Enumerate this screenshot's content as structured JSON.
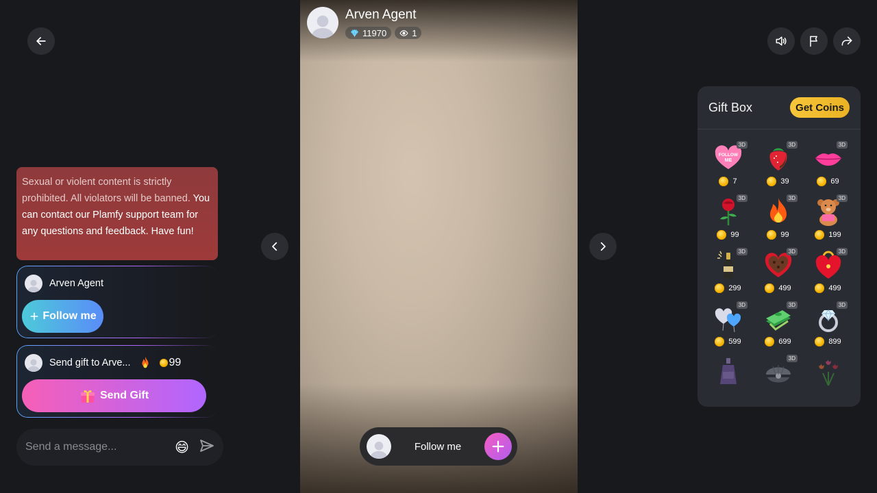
{
  "notice": {
    "text_muted": "Sexual or violent content is strictly prohibited. All violators will be banned.",
    "text_main": "You can contact our Plamfy support team for any questions and feedback. Have fun!"
  },
  "host": {
    "name": "Arven Agent",
    "diamonds": "11970",
    "viewers": "1"
  },
  "follow_card": {
    "name": "Arven Agent",
    "button_label": "Follow me"
  },
  "gift_card": {
    "text": "Send gift to Arve...",
    "gift_icon": "fire",
    "price": "99",
    "button_label": "Send Gift"
  },
  "message": {
    "placeholder": "Send a message..."
  },
  "follow_bar": {
    "label": "Follow me"
  },
  "giftbox": {
    "title": "Gift Box",
    "get_coins": "Get Coins",
    "badge": "3D",
    "items": [
      {
        "name": "follow-me-heart",
        "price": "7",
        "badge": true
      },
      {
        "name": "chocolate-strawberry",
        "price": "39",
        "badge": true
      },
      {
        "name": "lips",
        "price": "69",
        "badge": true
      },
      {
        "name": "rose",
        "price": "99",
        "badge": true
      },
      {
        "name": "fire",
        "price": "99",
        "badge": true
      },
      {
        "name": "teddy-bear",
        "price": "199",
        "badge": true
      },
      {
        "name": "champagne",
        "price": "299",
        "badge": true
      },
      {
        "name": "heart-chocolate-box",
        "price": "499",
        "badge": true
      },
      {
        "name": "heart-lock",
        "price": "499",
        "badge": true
      },
      {
        "name": "balloon-hearts",
        "price": "599",
        "badge": true
      },
      {
        "name": "money-stack",
        "price": "699",
        "badge": true
      },
      {
        "name": "diamond-ring",
        "price": "899",
        "badge": true
      },
      {
        "name": "perfume",
        "price": "",
        "badge": false
      },
      {
        "name": "pearl-shell",
        "price": "",
        "badge": true
      },
      {
        "name": "tulips",
        "price": "",
        "badge": false
      }
    ]
  },
  "colors": {
    "background": "#18191d",
    "notice": "#9a3b3c",
    "follow_gradient_start": "#4dcad9",
    "follow_gradient_end": "#5a8cf8",
    "gift_gradient_start": "#f65fb7",
    "gift_gradient_end": "#b066ff",
    "coins": "#f7c63a"
  }
}
